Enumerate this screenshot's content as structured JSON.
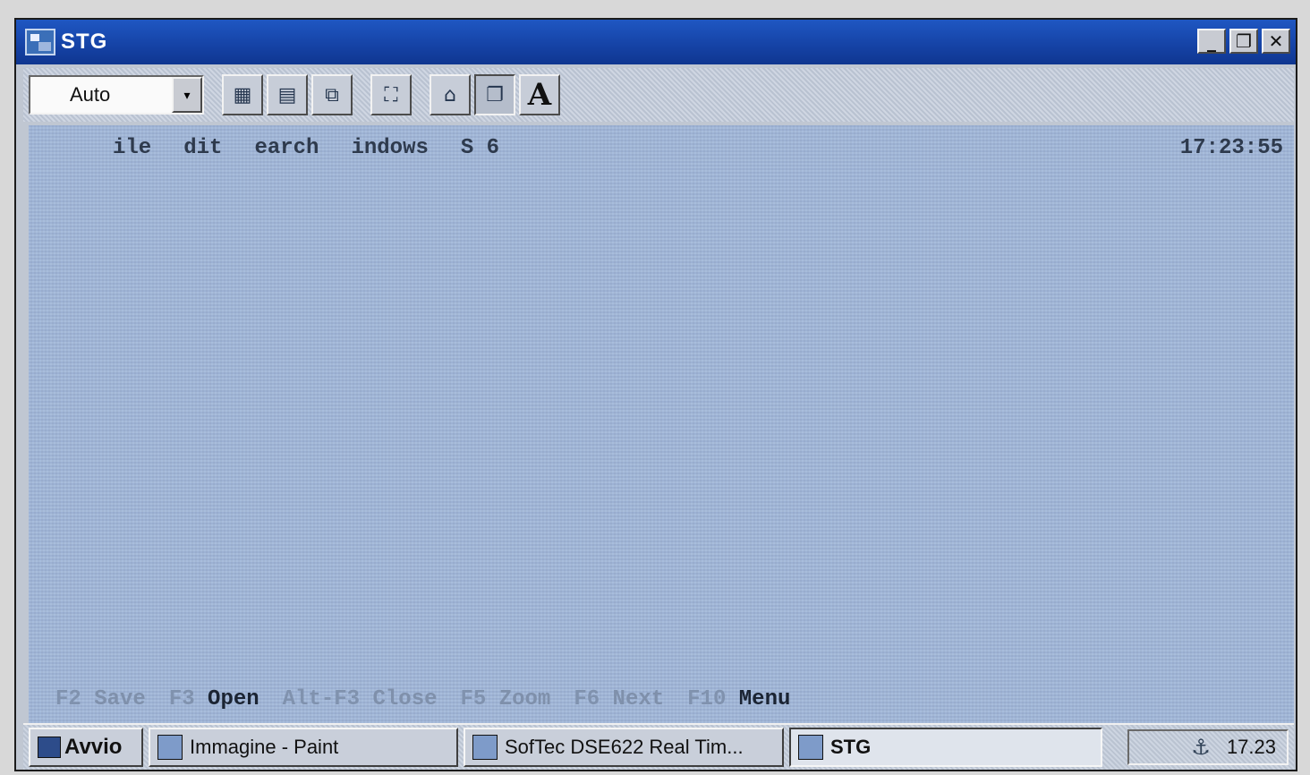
{
  "window": {
    "title": "STG",
    "controls": {
      "minimize": "_",
      "maximize": "❐",
      "close": "✕"
    }
  },
  "toolbar": {
    "font_select": "Auto",
    "dropdown_arrow": "▾",
    "tools": [
      {
        "name": "grid-select-icon",
        "glyph": "▦"
      },
      {
        "name": "table-icon",
        "glyph": "▤"
      },
      {
        "name": "copy-icon",
        "glyph": "⧉"
      },
      {
        "name": "fullscreen-icon",
        "glyph": "⛶"
      },
      {
        "name": "properties-icon",
        "glyph": "⌂"
      },
      {
        "name": "window-icon",
        "glyph": "❐"
      },
      {
        "name": "font-icon",
        "glyph": "A"
      }
    ]
  },
  "terminal": {
    "menu": [
      "ile",
      "dit",
      "earch",
      "indows",
      "S 6"
    ],
    "clock": "17:23:55",
    "fkeys": [
      {
        "key": "F2",
        "label": "Save"
      },
      {
        "key": "F3",
        "label": "Open"
      },
      {
        "key": "Alt-F3",
        "label": "Close"
      },
      {
        "key": "F5",
        "label": "Zoom"
      },
      {
        "key": "F6",
        "label": "Next"
      },
      {
        "key": "F10",
        "label": "Menu"
      }
    ]
  },
  "taskbar": {
    "start": "Avvio",
    "tasks": [
      {
        "label": "Immagine - Paint",
        "active": false
      },
      {
        "label": "SofTec DSE622 Real Tim...",
        "active": false
      },
      {
        "label": "STG",
        "active": true
      }
    ],
    "tray_time": "17.23",
    "tray_icon": "⚓"
  },
  "colors": {
    "title_bar": "#1542a5",
    "terminal_bg": "#a8bddc",
    "menu_text": "#2e3a4d"
  }
}
